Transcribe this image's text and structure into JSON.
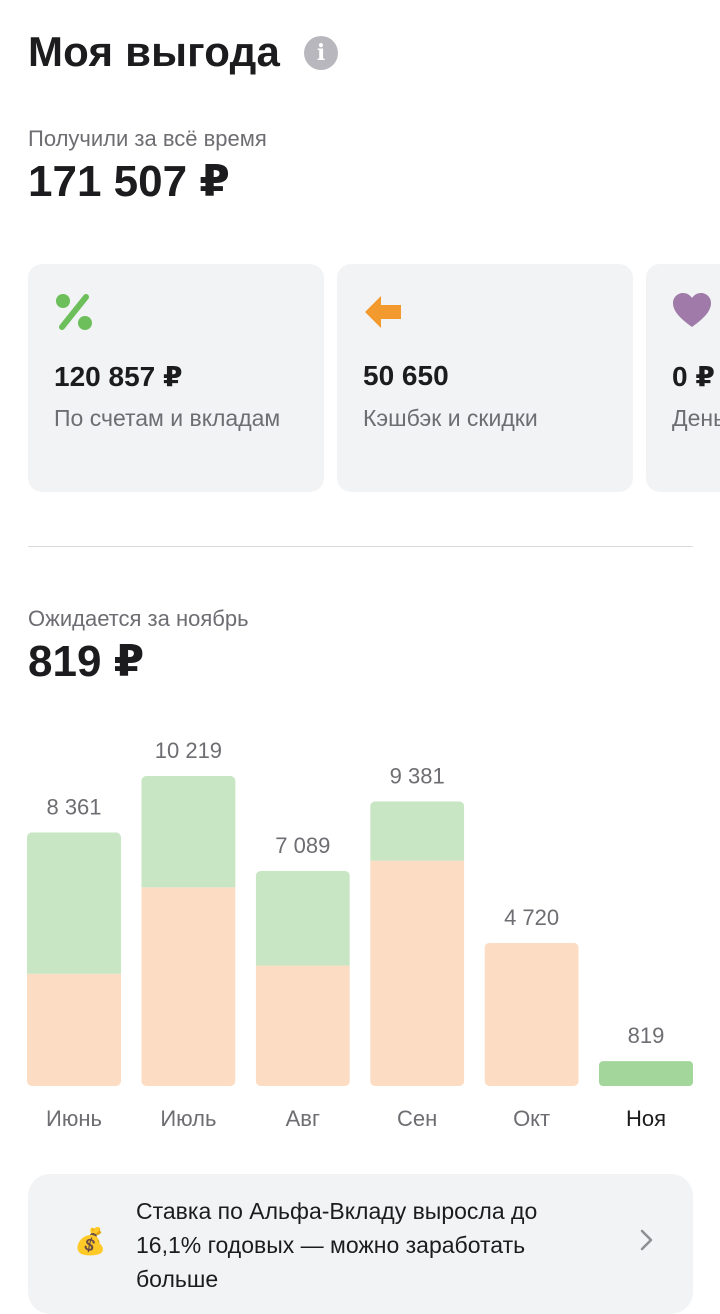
{
  "header": {
    "title": "Моя выгода",
    "info_icon": "info-icon"
  },
  "summary": {
    "label": "Получили за всё время",
    "value": "171 507 ₽"
  },
  "cards": [
    {
      "icon": "percent-icon",
      "color": "#6cbf5a",
      "value": "120 857 ₽",
      "label": "По счетам и вкладам"
    },
    {
      "icon": "arrow-left-icon",
      "color": "#f29a2e",
      "value": "50 650",
      "label": "Кэшбэк и скидки"
    },
    {
      "icon": "heart-icon",
      "color": "#a07aa8",
      "value": "0 ₽",
      "label": "Деньги за друзей"
    }
  ],
  "expected": {
    "label": "Ожидается за ноябрь",
    "value": "819 ₽"
  },
  "chart_data": {
    "type": "bar",
    "stacked": true,
    "categories": [
      "Июнь",
      "Июль",
      "Авг",
      "Сен",
      "Окт",
      "Ноя"
    ],
    "totals": [
      8361,
      10219,
      7089,
      9381,
      4720,
      819
    ],
    "total_labels": [
      "8 361",
      "10 219",
      "7 089",
      "9 381",
      "4 720",
      "819"
    ],
    "series": [
      {
        "color": "#fcdcc2",
        "values": [
          3700,
          6550,
          3970,
          7430,
          4720,
          0
        ]
      },
      {
        "color": "#c8e5c4",
        "values": [
          4661,
          3669,
          3119,
          1951,
          0,
          819
        ]
      }
    ],
    "highlight_category": "Ноя",
    "highlight_color": "#a3d69b"
  },
  "banner": {
    "icon": "money-bag-icon",
    "text": "Ставка по Альфа-Вкладу выросла до 16,1% годовых — можно заработать больше"
  }
}
